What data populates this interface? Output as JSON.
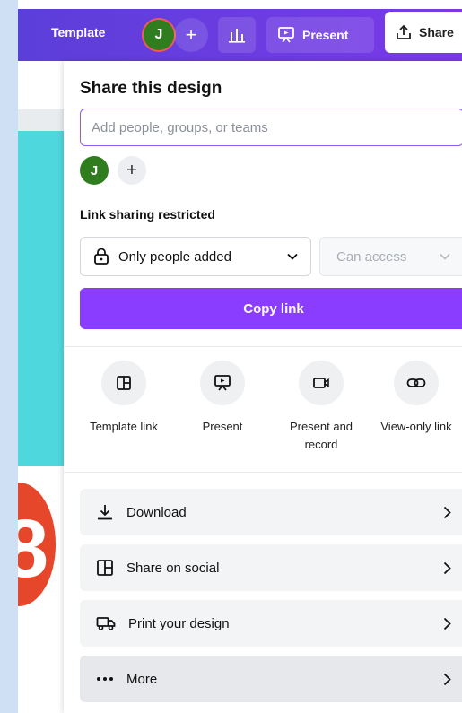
{
  "topbar": {
    "template_label": "Template",
    "avatar_initial": "J",
    "add_label": "+",
    "present_label": "Present",
    "share_label": "Share"
  },
  "background": {
    "big_digit": "8"
  },
  "share_panel": {
    "title": "Share this design",
    "input_placeholder": "Add people, groups, or teams",
    "avatar_initial": "J",
    "add_person_label": "+",
    "link_sharing_label": "Link sharing restricted",
    "people_select_value": "Only people added",
    "access_select_value": "Can access",
    "copy_link_label": "Copy link",
    "options": [
      {
        "label": "Template link",
        "icon": "template-icon"
      },
      {
        "label": "Present",
        "icon": "present-icon"
      },
      {
        "label": "Present and record",
        "icon": "record-icon"
      },
      {
        "label": "View-only link",
        "icon": "link-icon"
      }
    ],
    "rows": [
      {
        "label": "Download",
        "icon": "download-icon"
      },
      {
        "label": "Share on social",
        "icon": "social-icon"
      },
      {
        "label": "Print your design",
        "icon": "truck-icon"
      },
      {
        "label": "More",
        "icon": "more-icon"
      }
    ]
  },
  "colors": {
    "brand_purple": "#8b3dff",
    "topbar_start": "#5b3fd9",
    "topbar_end": "#7a39e8",
    "avatar_green": "#2f7d1e",
    "canvas_teal": "#4fd7de",
    "canvas_red": "#e6472a"
  }
}
